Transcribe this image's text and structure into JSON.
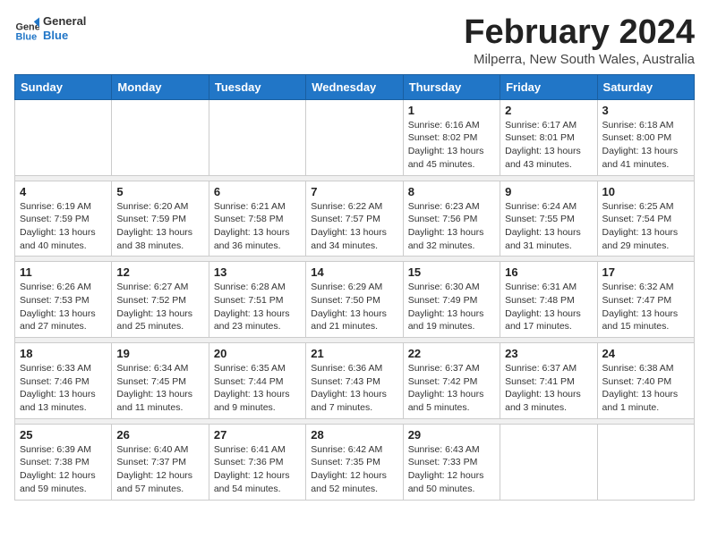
{
  "logo": {
    "line1": "General",
    "line2": "Blue"
  },
  "title": "February 2024",
  "subtitle": "Milperra, New South Wales, Australia",
  "weekdays": [
    "Sunday",
    "Monday",
    "Tuesday",
    "Wednesday",
    "Thursday",
    "Friday",
    "Saturday"
  ],
  "weeks": [
    [
      {
        "day": "",
        "info": ""
      },
      {
        "day": "",
        "info": ""
      },
      {
        "day": "",
        "info": ""
      },
      {
        "day": "",
        "info": ""
      },
      {
        "day": "1",
        "info": "Sunrise: 6:16 AM\nSunset: 8:02 PM\nDaylight: 13 hours\nand 45 minutes."
      },
      {
        "day": "2",
        "info": "Sunrise: 6:17 AM\nSunset: 8:01 PM\nDaylight: 13 hours\nand 43 minutes."
      },
      {
        "day": "3",
        "info": "Sunrise: 6:18 AM\nSunset: 8:00 PM\nDaylight: 13 hours\nand 41 minutes."
      }
    ],
    [
      {
        "day": "4",
        "info": "Sunrise: 6:19 AM\nSunset: 7:59 PM\nDaylight: 13 hours\nand 40 minutes."
      },
      {
        "day": "5",
        "info": "Sunrise: 6:20 AM\nSunset: 7:59 PM\nDaylight: 13 hours\nand 38 minutes."
      },
      {
        "day": "6",
        "info": "Sunrise: 6:21 AM\nSunset: 7:58 PM\nDaylight: 13 hours\nand 36 minutes."
      },
      {
        "day": "7",
        "info": "Sunrise: 6:22 AM\nSunset: 7:57 PM\nDaylight: 13 hours\nand 34 minutes."
      },
      {
        "day": "8",
        "info": "Sunrise: 6:23 AM\nSunset: 7:56 PM\nDaylight: 13 hours\nand 32 minutes."
      },
      {
        "day": "9",
        "info": "Sunrise: 6:24 AM\nSunset: 7:55 PM\nDaylight: 13 hours\nand 31 minutes."
      },
      {
        "day": "10",
        "info": "Sunrise: 6:25 AM\nSunset: 7:54 PM\nDaylight: 13 hours\nand 29 minutes."
      }
    ],
    [
      {
        "day": "11",
        "info": "Sunrise: 6:26 AM\nSunset: 7:53 PM\nDaylight: 13 hours\nand 27 minutes."
      },
      {
        "day": "12",
        "info": "Sunrise: 6:27 AM\nSunset: 7:52 PM\nDaylight: 13 hours\nand 25 minutes."
      },
      {
        "day": "13",
        "info": "Sunrise: 6:28 AM\nSunset: 7:51 PM\nDaylight: 13 hours\nand 23 minutes."
      },
      {
        "day": "14",
        "info": "Sunrise: 6:29 AM\nSunset: 7:50 PM\nDaylight: 13 hours\nand 21 minutes."
      },
      {
        "day": "15",
        "info": "Sunrise: 6:30 AM\nSunset: 7:49 PM\nDaylight: 13 hours\nand 19 minutes."
      },
      {
        "day": "16",
        "info": "Sunrise: 6:31 AM\nSunset: 7:48 PM\nDaylight: 13 hours\nand 17 minutes."
      },
      {
        "day": "17",
        "info": "Sunrise: 6:32 AM\nSunset: 7:47 PM\nDaylight: 13 hours\nand 15 minutes."
      }
    ],
    [
      {
        "day": "18",
        "info": "Sunrise: 6:33 AM\nSunset: 7:46 PM\nDaylight: 13 hours\nand 13 minutes."
      },
      {
        "day": "19",
        "info": "Sunrise: 6:34 AM\nSunset: 7:45 PM\nDaylight: 13 hours\nand 11 minutes."
      },
      {
        "day": "20",
        "info": "Sunrise: 6:35 AM\nSunset: 7:44 PM\nDaylight: 13 hours\nand 9 minutes."
      },
      {
        "day": "21",
        "info": "Sunrise: 6:36 AM\nSunset: 7:43 PM\nDaylight: 13 hours\nand 7 minutes."
      },
      {
        "day": "22",
        "info": "Sunrise: 6:37 AM\nSunset: 7:42 PM\nDaylight: 13 hours\nand 5 minutes."
      },
      {
        "day": "23",
        "info": "Sunrise: 6:37 AM\nSunset: 7:41 PM\nDaylight: 13 hours\nand 3 minutes."
      },
      {
        "day": "24",
        "info": "Sunrise: 6:38 AM\nSunset: 7:40 PM\nDaylight: 13 hours\nand 1 minute."
      }
    ],
    [
      {
        "day": "25",
        "info": "Sunrise: 6:39 AM\nSunset: 7:38 PM\nDaylight: 12 hours\nand 59 minutes."
      },
      {
        "day": "26",
        "info": "Sunrise: 6:40 AM\nSunset: 7:37 PM\nDaylight: 12 hours\nand 57 minutes."
      },
      {
        "day": "27",
        "info": "Sunrise: 6:41 AM\nSunset: 7:36 PM\nDaylight: 12 hours\nand 54 minutes."
      },
      {
        "day": "28",
        "info": "Sunrise: 6:42 AM\nSunset: 7:35 PM\nDaylight: 12 hours\nand 52 minutes."
      },
      {
        "day": "29",
        "info": "Sunrise: 6:43 AM\nSunset: 7:33 PM\nDaylight: 12 hours\nand 50 minutes."
      },
      {
        "day": "",
        "info": ""
      },
      {
        "day": "",
        "info": ""
      }
    ]
  ]
}
